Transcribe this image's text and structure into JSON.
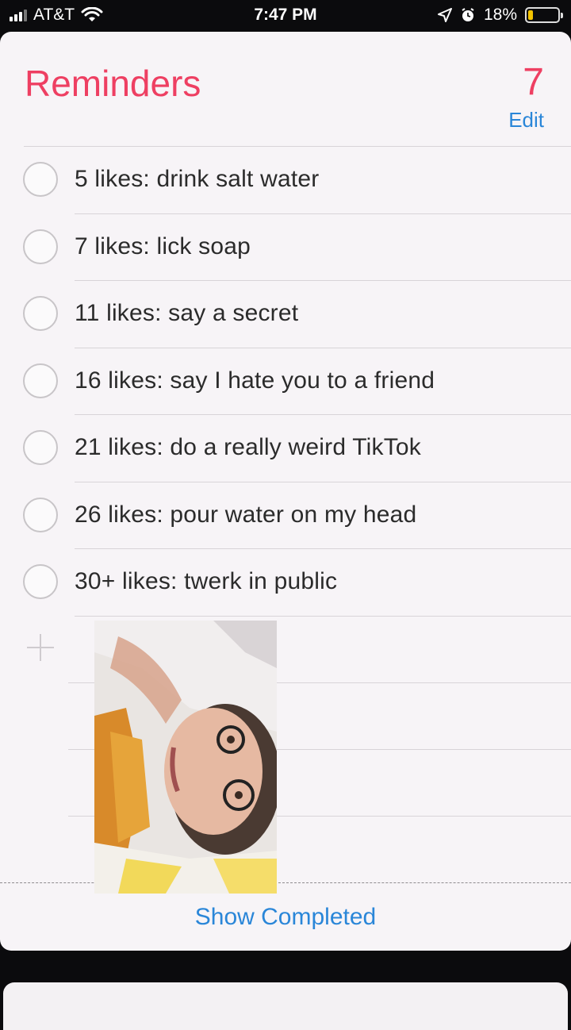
{
  "status_bar": {
    "carrier": "AT&T",
    "time": "7:47 PM",
    "battery_percent": "18%",
    "battery_level": 0.18,
    "icons": [
      "signal-icon",
      "wifi-icon",
      "location-icon",
      "alarm-icon",
      "battery-icon"
    ]
  },
  "reminders": {
    "title": "Reminders",
    "count": "7",
    "edit_label": "Edit",
    "items": [
      {
        "text": "5 likes: drink salt water"
      },
      {
        "text": "7 likes: lick soap"
      },
      {
        "text": "11 likes: say a secret"
      },
      {
        "text": "16 likes: say I hate you to a friend"
      },
      {
        "text": "21 likes: do a really weird TikTok"
      },
      {
        "text": "26 likes: pour water on my head"
      },
      {
        "text": "30+ likes: twerk in public"
      }
    ],
    "add_icon": "plus-icon",
    "show_completed_label": "Show Completed"
  },
  "colors": {
    "accent_red": "#ee3f62",
    "link_blue": "#2a86d8",
    "battery_yellow": "#f4c400"
  }
}
